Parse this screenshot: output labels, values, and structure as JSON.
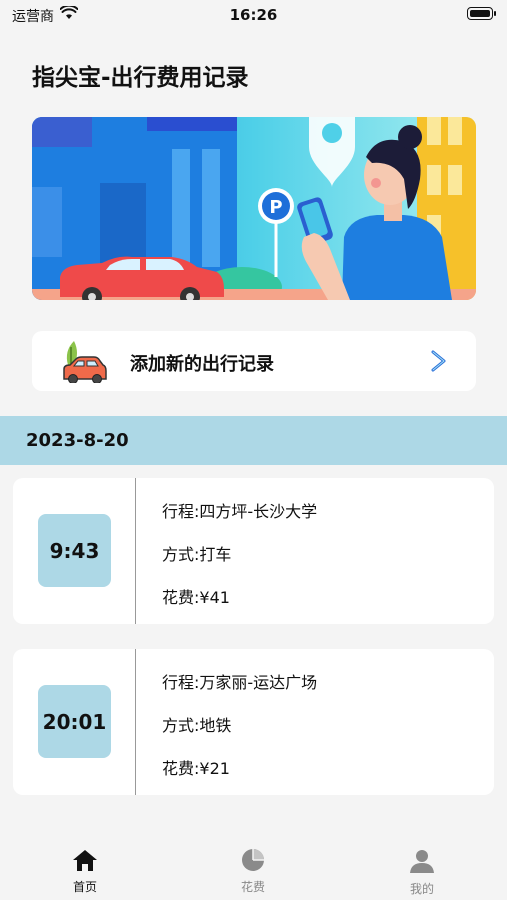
{
  "status_bar": {
    "carrier": "运营商",
    "time": "16:26"
  },
  "header": {
    "title": "指尖宝-出行费用记录"
  },
  "add_record": {
    "label": "添加新的出行记录"
  },
  "date_group": {
    "date": "2023-8-20"
  },
  "records": [
    {
      "time": "9:43",
      "route": "行程:四方坪-长沙大学",
      "mode": "方式:打车",
      "cost": "花费:¥41"
    },
    {
      "time": "20:01",
      "route": "行程:万家丽-运达广场",
      "mode": "方式:地铁",
      "cost": "花费:¥21"
    }
  ],
  "tabbar": {
    "items": [
      {
        "label": "首页",
        "icon": "home-icon",
        "active": true
      },
      {
        "label": "花费",
        "icon": "pie-chart-icon",
        "active": false
      },
      {
        "label": "我的",
        "icon": "user-icon",
        "active": false
      }
    ]
  },
  "colors": {
    "accent": "#add8e6",
    "background": "#f4f4f4",
    "card": "#ffffff"
  }
}
